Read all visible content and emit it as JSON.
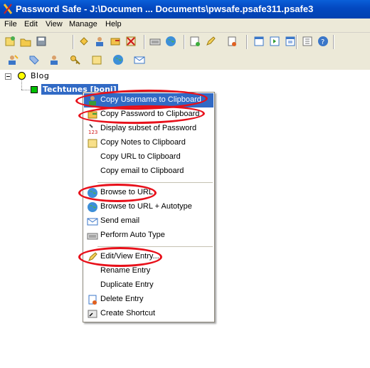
{
  "window": {
    "title": "Password Safe - J:\\Documen ... Documents\\pwsafe.psafe311.psafe3"
  },
  "menu": [
    "File",
    "Edit",
    "View",
    "Manage",
    "Help"
  ],
  "toolbar1_icons": [
    "new-db-icon",
    "open-db-icon",
    "save-db-icon",
    "add-entry-icon",
    "copy-username-icon",
    "copy-password-icon",
    "delete-entry-icon",
    "autotype-icon",
    "browse-url-icon",
    "add-group-icon",
    "edit-entry-icon",
    "expand-all-icon",
    "collapse-all-icon",
    "options-icon",
    "help-icon"
  ],
  "toolbar2_icons": [
    "copy-user-icon",
    "tag-icon",
    "user-icon",
    "key-icon",
    "notes-icon",
    "globe-icon",
    "email-icon"
  ],
  "tree": {
    "group": "Blog",
    "entry": "Techtunes [boni]"
  },
  "context_menu": [
    {
      "label": "Copy Username to Clipboard",
      "icon": "copy-username-icon",
      "highlighted": true
    },
    {
      "label": "Copy Password to Clipboard",
      "icon": "copy-password-icon"
    },
    {
      "label": "Display subset of Password",
      "icon": "password-subset-icon"
    },
    {
      "label": "Copy Notes to Clipboard",
      "icon": "copy-notes-icon"
    },
    {
      "label": "Copy URL to Clipboard",
      "icon": ""
    },
    {
      "label": "Copy email to Clipboard",
      "icon": ""
    },
    {
      "label": "Browse to URL",
      "icon": "browse-url-icon"
    },
    {
      "label": "Browse to URL + Autotype",
      "icon": "browse-autotype-icon"
    },
    {
      "label": "Send email",
      "icon": "send-email-icon"
    },
    {
      "label": "Perform Auto Type",
      "icon": "autotype-icon"
    },
    {
      "label": "Edit/View Entry...",
      "icon": "edit-entry-icon"
    },
    {
      "label": "Rename Entry",
      "icon": ""
    },
    {
      "label": "Duplicate Entry",
      "icon": ""
    },
    {
      "label": "Delete Entry",
      "icon": "delete-entry-icon"
    },
    {
      "label": "Create Shortcut",
      "icon": "shortcut-icon"
    }
  ],
  "colors": {
    "titlebar": "#0348c0",
    "highlight": "#316ac5",
    "annotation": "#e8101a"
  }
}
